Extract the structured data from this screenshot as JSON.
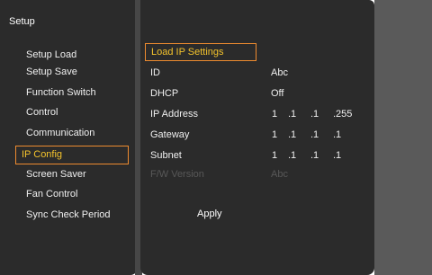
{
  "setup": {
    "title": "Setup",
    "menu": [
      {
        "label": "Setup Load"
      },
      {
        "label": "Setup Save"
      },
      {
        "label": "Function Switch"
      },
      {
        "label": "Control"
      },
      {
        "label": "Communication"
      },
      {
        "label": "IP Config",
        "selected": true
      },
      {
        "label": "Screen Saver"
      },
      {
        "label": "Fan Control"
      },
      {
        "label": "Sync Check Period"
      }
    ]
  },
  "ip_config": {
    "load_button": "Load IP Settings",
    "id_label": "ID",
    "id_value": "Abc",
    "dhcp_label": "DHCP",
    "dhcp_value": "Off",
    "ip_label": "IP Address",
    "ip_octets": [
      "1",
      ".1",
      ".1",
      ".255"
    ],
    "gateway_label": "Gateway",
    "gateway_octets": [
      "1",
      ".1",
      ".1",
      ".1"
    ],
    "subnet_label": "Subnet",
    "subnet_octets": [
      "1",
      ".1",
      ".1",
      ".1"
    ],
    "fw_label": "F/W Version",
    "fw_value": "Abc",
    "apply_label": "Apply"
  },
  "colors": {
    "panel": "#2b2b2b",
    "highlight_border": "#ee8b2f",
    "highlight_text": "#f4c32c",
    "text": "#f0f0f0",
    "disabled_text": "#585858"
  }
}
